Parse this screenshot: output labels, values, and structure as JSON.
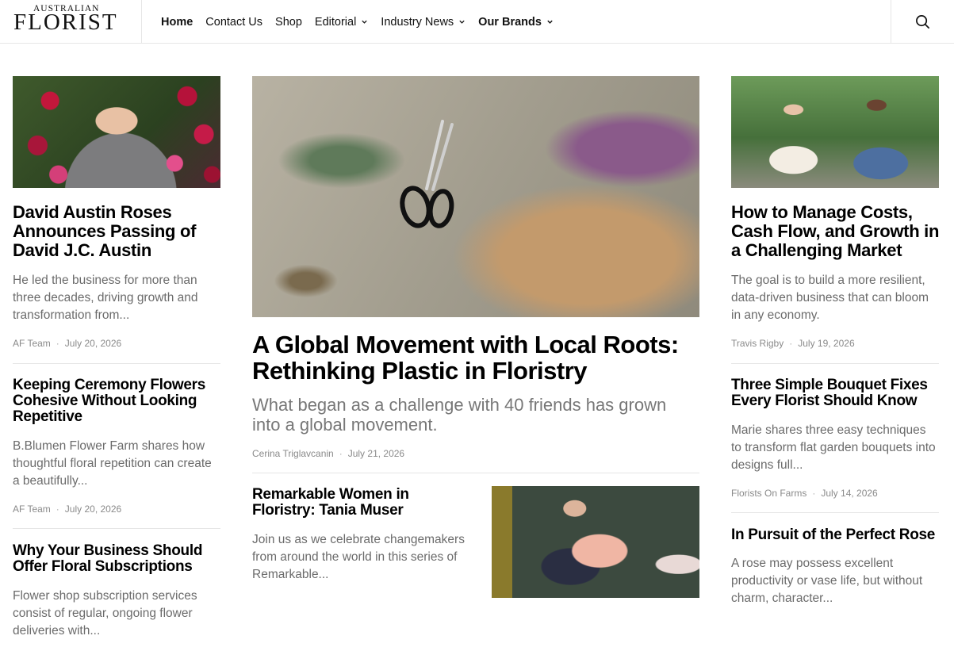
{
  "logo": {
    "top_text": "AUSTRALIAN",
    "main_text": "FLORIST"
  },
  "nav": {
    "items": [
      {
        "label": "Home",
        "bold": true,
        "dropdown": false
      },
      {
        "label": "Contact Us",
        "bold": false,
        "dropdown": false
      },
      {
        "label": "Shop",
        "bold": false,
        "dropdown": false
      },
      {
        "label": "Editorial",
        "bold": false,
        "dropdown": true
      },
      {
        "label": "Industry News",
        "bold": false,
        "dropdown": true
      },
      {
        "label": "Our Brands",
        "bold": true,
        "dropdown": true
      }
    ],
    "search_icon": "search-icon"
  },
  "left": {
    "articles": [
      {
        "title": "David Austin Roses Announces Passing of David J.C. Austin",
        "excerpt": "He led the business for more than three decades, driving growth and transformation from...",
        "author": "AF Team",
        "date": "July 20, 2026"
      },
      {
        "title": "Keeping Ceremony Flowers Cohesive Without Looking Repetitive",
        "excerpt": "B.Blumen Flower Farm shares how thoughtful floral repetition can create a beautifully...",
        "author": "AF Team",
        "date": "July 20, 2026"
      },
      {
        "title": "Why Your Business Should Offer Floral Subscriptions",
        "excerpt": "Flower shop subscription services consist of regular, ongoing flower deliveries with..."
      }
    ]
  },
  "center": {
    "hero": {
      "title": "A Global Movement with Local Roots: Rethinking Plastic in Floristry",
      "excerpt": "What began as a challenge with 40 friends has grown into a global movement.",
      "author": "Cerina Triglavcanin",
      "date": "July 21, 2026"
    },
    "secondary": {
      "title": "Remarkable Women in Floristry: Tania Muser",
      "excerpt": "Join us as we celebrate changemakers from around the world in this series of Remarkable..."
    }
  },
  "right": {
    "articles": [
      {
        "title": "How to Manage Costs, Cash Flow, and Growth in a Challenging Market",
        "excerpt": "The goal is to build a more resilient, data-driven business that can bloom in any economy.",
        "author": "Travis Rigby",
        "date": "July 19, 2026"
      },
      {
        "title": "Three Simple Bouquet Fixes Every Florist Should Know",
        "excerpt": "Marie shares three easy techniques to transform flat garden bouquets into designs full...",
        "author": "Florists On Farms",
        "date": "July 14, 2026"
      },
      {
        "title": "In Pursuit of the Perfect Rose",
        "excerpt": "A rose may possess excellent productivity or vase life, but without charm, character..."
      }
    ]
  },
  "meta_separator": "·"
}
